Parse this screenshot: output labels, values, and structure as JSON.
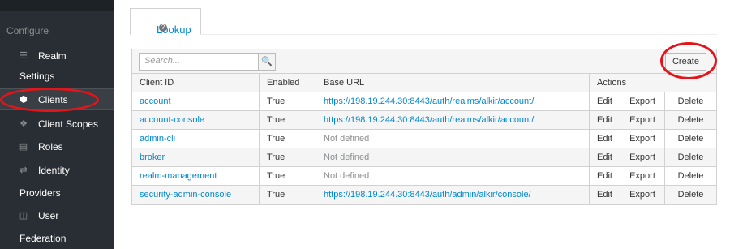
{
  "sidebar": {
    "section": "Configure",
    "items": [
      {
        "icon": "sliders-icon",
        "line1": "Realm",
        "line2": "Settings"
      },
      {
        "icon": "cube-icon",
        "line1": "Clients"
      },
      {
        "icon": "cubes-icon",
        "line1": "Client Scopes"
      },
      {
        "icon": "list-icon",
        "line1": "Roles"
      },
      {
        "icon": "exchange-icon",
        "line1": "Identity",
        "line2": "Providers"
      },
      {
        "icon": "database-icon",
        "line1": "User",
        "line2": "Federation"
      }
    ]
  },
  "tabs": [
    {
      "label": "Lookup"
    }
  ],
  "search": {
    "placeholder": "Search..."
  },
  "toolbar": {
    "create_label": "Create"
  },
  "table": {
    "headers": [
      "Client ID",
      "Enabled",
      "Base URL",
      "Actions"
    ],
    "rows": [
      {
        "client_id": "account",
        "enabled": "True",
        "base_url": "https://198.19.244.30:8443/auth/realms/alkir/account/",
        "actions": [
          "Edit",
          "Export",
          "Delete"
        ]
      },
      {
        "client_id": "account-console",
        "enabled": "True",
        "base_url": "https://198.19.244.30:8443/auth/realms/alkir/account/",
        "actions": [
          "Edit",
          "Export",
          "Delete"
        ]
      },
      {
        "client_id": "admin-cli",
        "enabled": "True",
        "base_url": "Not defined",
        "actions": [
          "Edit",
          "Export",
          "Delete"
        ]
      },
      {
        "client_id": "broker",
        "enabled": "True",
        "base_url": "Not defined",
        "actions": [
          "Edit",
          "Export",
          "Delete"
        ]
      },
      {
        "client_id": "realm-management",
        "enabled": "True",
        "base_url": "Not defined",
        "actions": [
          "Edit",
          "Export",
          "Delete"
        ]
      },
      {
        "client_id": "security-admin-console",
        "enabled": "True",
        "base_url": "https://198.19.244.30:8443/auth/admin/alkir/console/",
        "actions": [
          "Edit",
          "Export",
          "Delete"
        ]
      }
    ]
  },
  "colors": {
    "sidebar_bg": "#292e34",
    "link": "#0088ce",
    "annotation": "#e4141b"
  }
}
